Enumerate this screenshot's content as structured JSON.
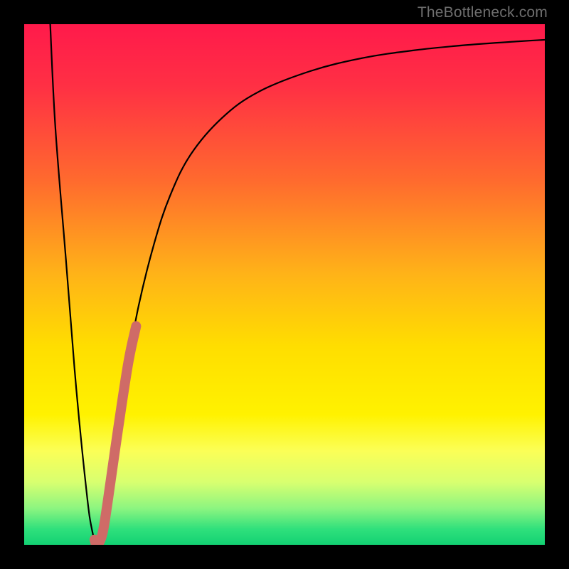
{
  "watermark": "TheBottleneck.com",
  "colors": {
    "frame": "#000000",
    "gradient_stops": [
      {
        "offset": 0.0,
        "color": "#ff1a4b"
      },
      {
        "offset": 0.12,
        "color": "#ff3044"
      },
      {
        "offset": 0.3,
        "color": "#ff6a2e"
      },
      {
        "offset": 0.48,
        "color": "#ffb318"
      },
      {
        "offset": 0.62,
        "color": "#ffde00"
      },
      {
        "offset": 0.75,
        "color": "#fff200"
      },
      {
        "offset": 0.82,
        "color": "#fbff57"
      },
      {
        "offset": 0.88,
        "color": "#d8ff70"
      },
      {
        "offset": 0.93,
        "color": "#8cf580"
      },
      {
        "offset": 0.97,
        "color": "#2fe07c"
      },
      {
        "offset": 1.0,
        "color": "#13d173"
      }
    ],
    "curve": "#000000",
    "thick_segment": "#cf6b67"
  },
  "chart_data": {
    "type": "line",
    "title": "",
    "xlabel": "",
    "ylabel": "",
    "xlim": [
      0,
      100
    ],
    "ylim": [
      0,
      100
    ],
    "series": [
      {
        "name": "bottleneck-curve",
        "x": [
          5,
          6,
          8,
          10,
          12,
          13,
          14,
          15,
          16,
          18,
          20,
          22,
          25,
          28,
          32,
          38,
          45,
          55,
          65,
          75,
          85,
          95,
          100
        ],
        "values": [
          100,
          80,
          55,
          30,
          10,
          3,
          0,
          2,
          8,
          22,
          35,
          46,
          58,
          67,
          75,
          82,
          87,
          91,
          93.5,
          95,
          96,
          96.7,
          97
        ]
      }
    ],
    "annotations": [
      {
        "name": "highlighted-segment",
        "style": "thick",
        "x": [
          13.5,
          14,
          15,
          16,
          18,
          20,
          21.5
        ],
        "values": [
          1,
          0,
          2,
          8,
          22,
          35,
          42
        ]
      }
    ]
  }
}
